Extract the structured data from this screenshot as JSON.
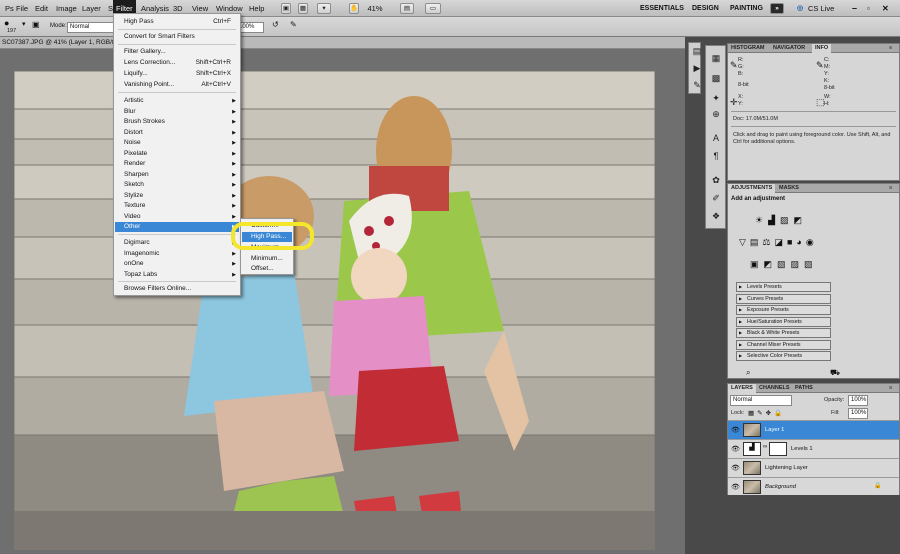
{
  "menubar": {
    "items": [
      "File",
      "Edit",
      "Image",
      "Layer",
      "Select",
      "Filter",
      "Analysis",
      "3D",
      "View",
      "Window",
      "Help"
    ],
    "zoom": "41%",
    "workspaces": [
      "ESSENTIALS",
      "DESIGN",
      "PAINTING"
    ],
    "expand": "»",
    "cs_live": "CS Live"
  },
  "options": {
    "size": "197",
    "mode_label": "Mode:",
    "mode_value": "Normal",
    "opacity_value": "100%"
  },
  "document": {
    "tab": "SC07387.JPG @ 41% (Layer 1, RGB/8*)"
  },
  "filter_menu": {
    "top": [
      {
        "label": "High Pass",
        "shortcut": "Ctrl+F"
      },
      {
        "label": "Convert for Smart Filters",
        "shortcut": ""
      },
      {
        "label": "Filter Gallery...",
        "shortcut": ""
      },
      {
        "label": "Lens Correction...",
        "shortcut": "Shift+Ctrl+R"
      },
      {
        "label": "Liquify...",
        "shortcut": "Shift+Ctrl+X"
      },
      {
        "label": "Vanishing Point...",
        "shortcut": "Alt+Ctrl+V"
      }
    ],
    "categories": [
      "Artistic",
      "Blur",
      "Brush Strokes",
      "Distort",
      "Noise",
      "Pixelate",
      "Render",
      "Sharpen",
      "Sketch",
      "Stylize",
      "Texture",
      "Video",
      "Other"
    ],
    "plugins": [
      "Digimarc",
      "Imagenomic",
      "onOne",
      "Topaz Labs"
    ],
    "browse": "Browse Filters Online..."
  },
  "other_submenu": [
    "Custom...",
    "High Pass...",
    "Maximum...",
    "Minimum...",
    "Offset..."
  ],
  "info_panel": {
    "tabs": [
      "HISTOGRAM",
      "NAVIGATOR",
      "INFO"
    ],
    "rgb": [
      "R:",
      "G:",
      "B:"
    ],
    "cmyk": [
      "C:",
      "M:",
      "Y:",
      "K:"
    ],
    "bits1": "8-bit",
    "bits2": "8-bit",
    "xy": [
      "X:",
      "Y:"
    ],
    "wh": [
      "W:",
      "H:"
    ],
    "doc": "Doc: 17.0M/51.0M",
    "hint": "Click and drag to paint using foreground color.  Use Shift, Alt, and Ctrl for additional options."
  },
  "adjustments_panel": {
    "tabs": [
      "ADJUSTMENTS",
      "MASKS"
    ],
    "title": "Add an adjustment",
    "presets": [
      "Levels Presets",
      "Curves Presets",
      "Exposure Presets",
      "Hue/Saturation Presets",
      "Black & White Presets",
      "Channel Mixer Presets",
      "Selective Color Presets"
    ]
  },
  "layers_panel": {
    "tabs": [
      "LAYERS",
      "CHANNELS",
      "PATHS"
    ],
    "blend": "Normal",
    "opacity_label": "Opacity:",
    "opacity": "100%",
    "lock_label": "Lock:",
    "fill_label": "Fill:",
    "fill": "100%",
    "layers": [
      "Layer 1",
      "Levels 1",
      "Lightening Layer",
      "Background"
    ]
  },
  "colors": {
    "menu_highlight": "#3a87d6",
    "callout": "#f3e62b"
  }
}
